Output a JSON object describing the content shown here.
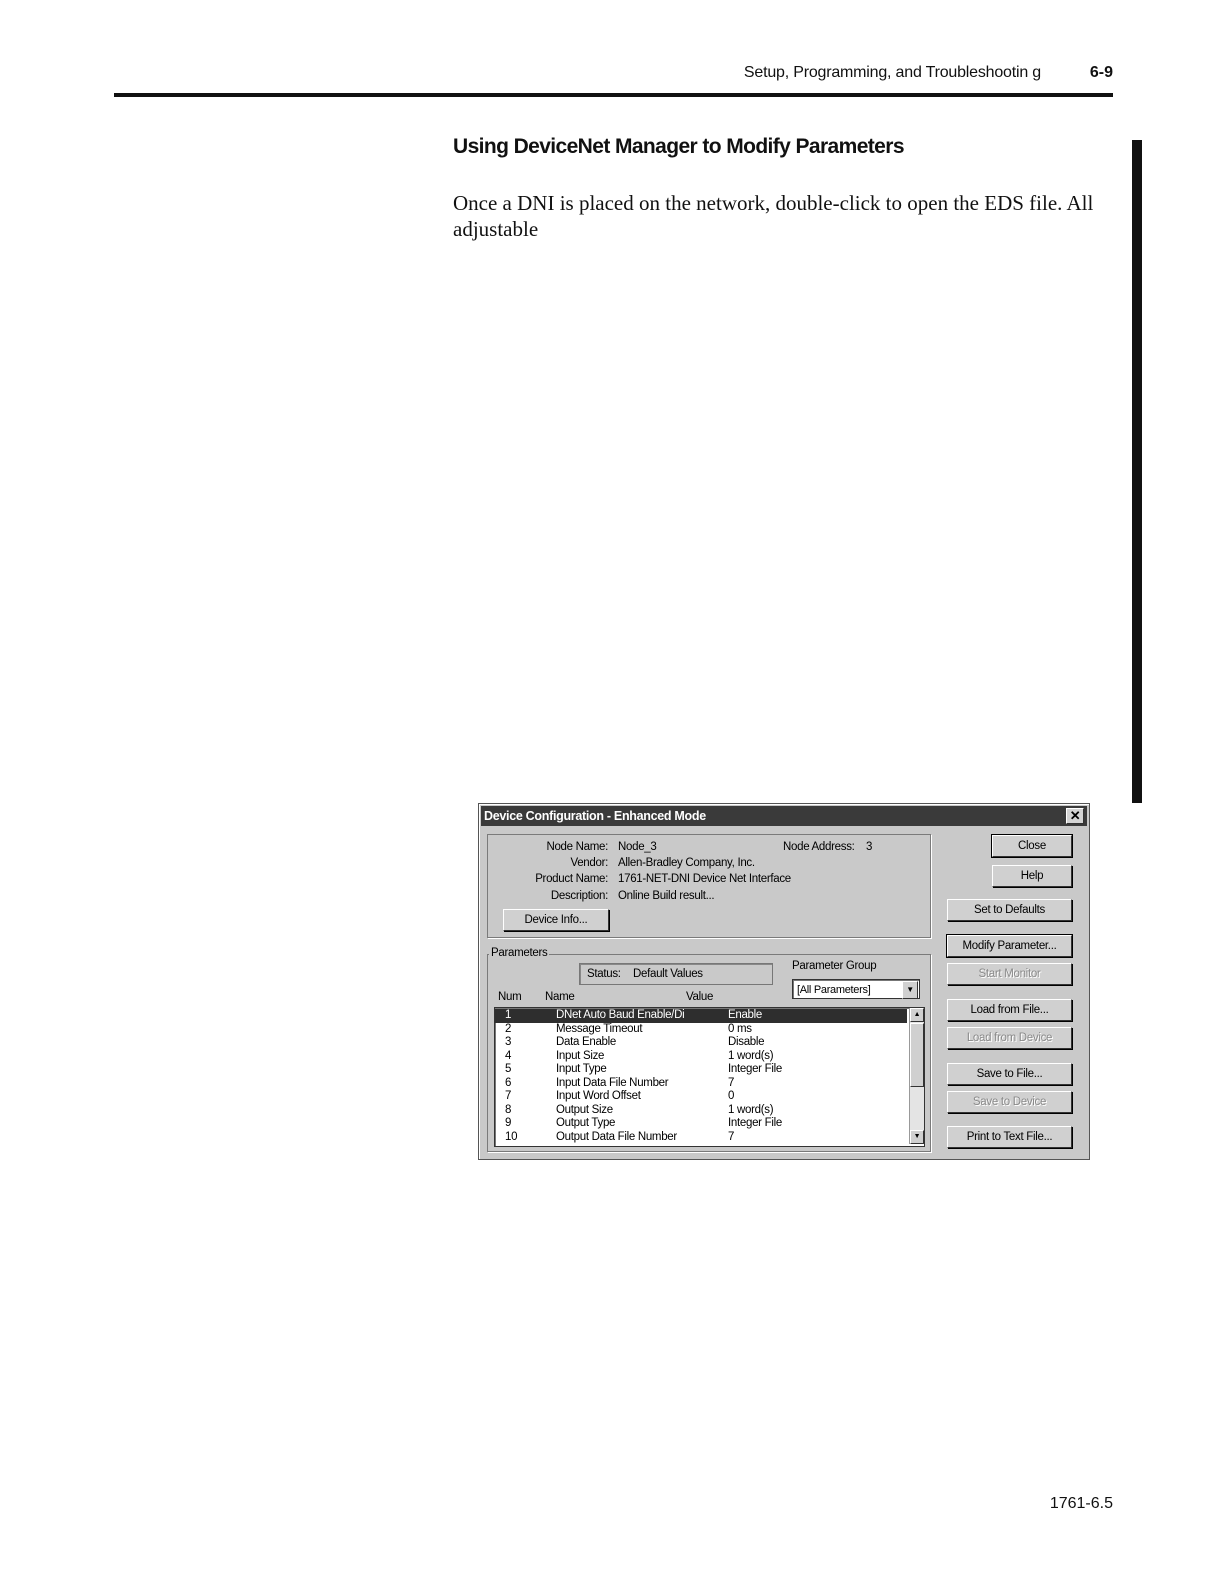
{
  "header": {
    "section_title": "Setup, Programming, and Troubleshootin g",
    "page_number": "6-9"
  },
  "content": {
    "heading": "Using DeviceNet Manager to Modify Parameters",
    "paragraph": "Once a DNI is placed on the network, double-click to open the EDS file. All adjustable"
  },
  "dialog": {
    "title": "Device Configuration - Enhanced Mode",
    "info": {
      "node_name_label": "Node Name:",
      "node_name": "Node_3",
      "node_address_label": "Node Address:",
      "node_address": "3",
      "vendor_label": "Vendor:",
      "vendor": "Allen-Bradley Company, Inc.",
      "product_name_label": "Product Name:",
      "product_name": "1761-NET-DNI Device Net Interface",
      "description_label": "Description:",
      "description": "Online Build result..."
    },
    "device_info_button": "Device Info...",
    "parameters_label": "Parameters",
    "status_label": "Status:",
    "status_value": "Default Values",
    "parameter_group_label": "Parameter Group",
    "parameter_group_value": "[All Parameters]",
    "columns": {
      "num": "Num",
      "name": "Name",
      "value": "Value"
    },
    "rows": [
      {
        "num": "1",
        "name": "DNet Auto Baud Enable/Di",
        "value": "Enable"
      },
      {
        "num": "2",
        "name": "Message Timeout",
        "value": "0 ms"
      },
      {
        "num": "3",
        "name": "Data Enable",
        "value": "Disable"
      },
      {
        "num": "4",
        "name": "Input Size",
        "value": "1 word(s)"
      },
      {
        "num": "5",
        "name": "Input Type",
        "value": "Integer File"
      },
      {
        "num": "6",
        "name": "Input Data File Number",
        "value": "7"
      },
      {
        "num": "7",
        "name": "Input Word Offset",
        "value": "0"
      },
      {
        "num": "8",
        "name": "Output Size",
        "value": "1 word(s)"
      },
      {
        "num": "9",
        "name": "Output Type",
        "value": "Integer File"
      },
      {
        "num": "10",
        "name": "Output Data File Number",
        "value": "7"
      }
    ],
    "buttons": {
      "close": "Close",
      "help": "Help",
      "set_defaults": "Set to Defaults",
      "modify_parameter": "Modify Parameter...",
      "start_monitor": "Start Monitor",
      "load_from_file": "Load from File...",
      "load_from_device": "Load from Device",
      "save_to_file": "Save to File...",
      "save_to_device": "Save to Device",
      "print_to_text": "Print to Text File..."
    }
  },
  "footer": {
    "doc_number": "1761-6.5"
  },
  "colors": {
    "titlebar": "#3a3a3a",
    "dialog_face": "#c9c9c9",
    "selection": "#2e2e2e"
  }
}
